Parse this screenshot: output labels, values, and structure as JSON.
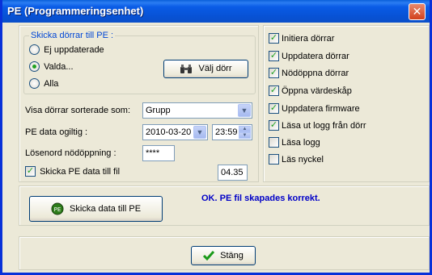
{
  "window": {
    "title": "PE (Programmeringsenhet)",
    "close_glyph": "✕"
  },
  "group": {
    "label": "Skicka dörrar till PE :",
    "radios": [
      {
        "label": "Ej uppdaterade",
        "selected": false
      },
      {
        "label": "Valda...",
        "selected": true
      },
      {
        "label": "Alla",
        "selected": false
      }
    ],
    "select_door_button": "Välj dörr"
  },
  "form": {
    "sort_label": "Visa dörrar sorterade som:",
    "sort_value": "Grupp",
    "expiry_label": "PE data ogiltig :",
    "expiry_date": "2010-03-20",
    "expiry_time": "23:59",
    "password_label": "Lösenord nödöppning :",
    "password_value": "****",
    "send_file_label": "Skicka PE data till fil",
    "send_file_checked": true,
    "version_value": "04.35"
  },
  "options": [
    {
      "label": "Initiera dörrar",
      "checked": true
    },
    {
      "label": "Uppdatera dörrar",
      "checked": true
    },
    {
      "label": "Nödöppna dörrar",
      "checked": true
    },
    {
      "label": "Öppna värdeskåp",
      "checked": true
    },
    {
      "label": "Uppdatera firmware",
      "checked": true
    },
    {
      "label": "Läsa ut logg från dörr",
      "checked": true
    },
    {
      "label": "Läsa logg",
      "checked": false
    },
    {
      "label": "Läs nyckel",
      "checked": false
    }
  ],
  "action": {
    "send_button": "Skicka data till PE",
    "status_text": "OK. PE fil skapades korrekt.",
    "status_color": "#0000c8"
  },
  "footer": {
    "close_button": "Stäng"
  },
  "icons": {
    "binoculars": "binoculars-icon",
    "pe_device": "pe-device-icon",
    "checkmark": "checkmark-icon"
  }
}
